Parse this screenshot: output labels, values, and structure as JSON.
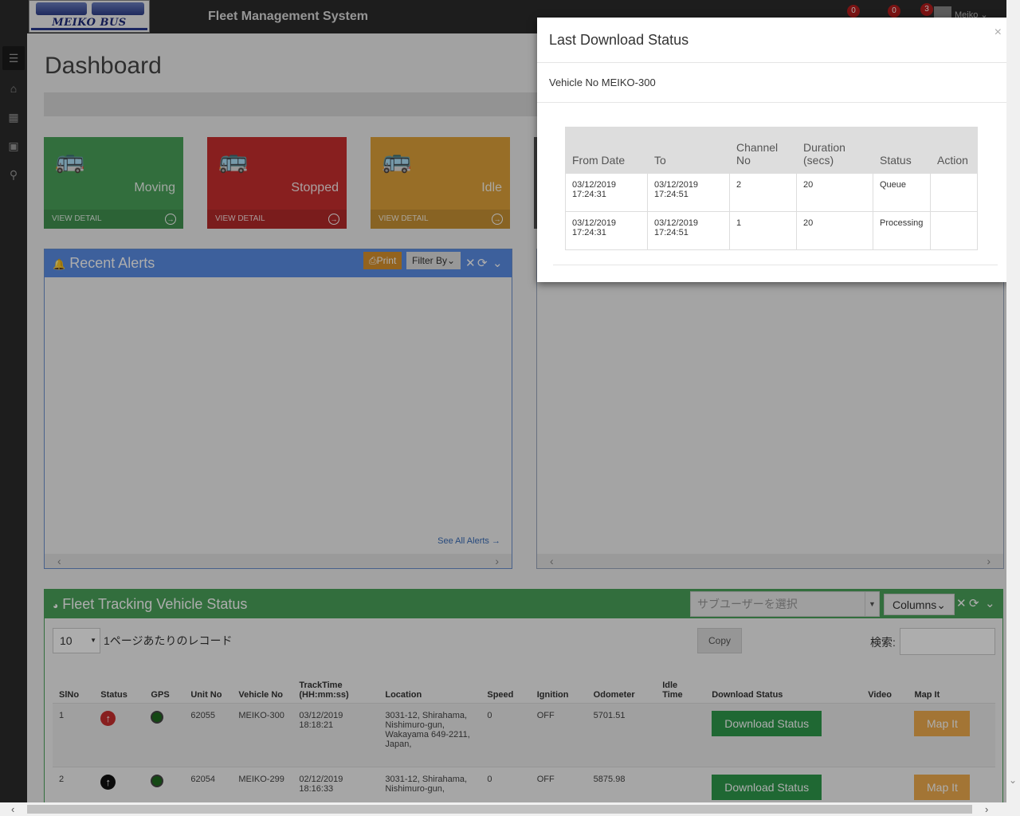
{
  "header": {
    "logo_text": "MEIKO BUS",
    "app_title": "Fleet Management System",
    "badges": [
      "0",
      "0",
      "3"
    ],
    "user_name": "Meiko"
  },
  "sidebar": {
    "items": [
      {
        "icon": "menu-icon"
      },
      {
        "icon": "home-icon"
      },
      {
        "icon": "table-icon"
      },
      {
        "icon": "bus-icon"
      },
      {
        "icon": "location-pin-icon"
      }
    ]
  },
  "dashboard": {
    "title": "Dashboard",
    "tiles": [
      {
        "label": "Moving",
        "detail": "VIEW DETAIL",
        "color": "#4aa35a"
      },
      {
        "label": "Stopped",
        "detail": "VIEW DETAIL",
        "color": "#c92f2f"
      },
      {
        "label": "Idle",
        "detail": "VIEW DETAIL",
        "color": "#e0a33a"
      }
    ]
  },
  "alerts": {
    "title": "Recent Alerts",
    "print_label": "Print",
    "filter_label": "Filter By",
    "see_all": "See All Alerts"
  },
  "fleet": {
    "title": "Fleet Tracking Vehicle Status",
    "subuser_placeholder": "サブユーザーを選択",
    "columns_label": "Columns",
    "page_length": "10",
    "page_length_label": "1ページあたりのレコード",
    "copy_label": "Copy",
    "search_label": "検索:",
    "headers": [
      "SlNo",
      "Status",
      "GPS",
      "Unit No",
      "Vehicle No",
      "TrackTime (HH:mm:ss)",
      "Location",
      "Speed",
      "Ignition",
      "Odometer",
      "Idle Time",
      "Download Status",
      "Video",
      "Map It"
    ],
    "rows": [
      {
        "slno": "1",
        "status": "moving-up-red",
        "unit": "62055",
        "vehicle": "MEIKO-300",
        "tracktime": "03/12/2019 18:18:21",
        "location": "3031-12, Shirahama, Nishimuro-gun, Wakayama 649-2211, Japan,",
        "speed": "0",
        "ignition": "OFF",
        "odometer": "5701.51",
        "idle": "",
        "download": "Download Status",
        "video": "",
        "map": "Map It"
      },
      {
        "slno": "2",
        "status": "moving-up-black",
        "unit": "62054",
        "vehicle": "MEIKO-299",
        "tracktime": "02/12/2019 18:16:33",
        "location": "3031-12, Shirahama, Nishimuro-gun,",
        "speed": "0",
        "ignition": "OFF",
        "odometer": "5875.98",
        "idle": "",
        "download": "Download Status",
        "video": "",
        "map": "Map It"
      }
    ]
  },
  "modal": {
    "title": "Last Download Status",
    "close": "×",
    "vehicle_line": "Vehicle No MEIKO-300",
    "headers": [
      "From Date",
      "To",
      "Channel No",
      "Duration (secs)",
      "Status",
      "Action"
    ],
    "rows": [
      {
        "from": "03/12/2019 17:24:31",
        "to": "03/12/2019 17:24:51",
        "channel": "2",
        "duration": "20",
        "status": "Queue",
        "action": ""
      },
      {
        "from": "03/12/2019 17:24:31",
        "to": "03/12/2019 17:24:51",
        "channel": "1",
        "duration": "20",
        "status": "Processing",
        "action": ""
      }
    ]
  }
}
